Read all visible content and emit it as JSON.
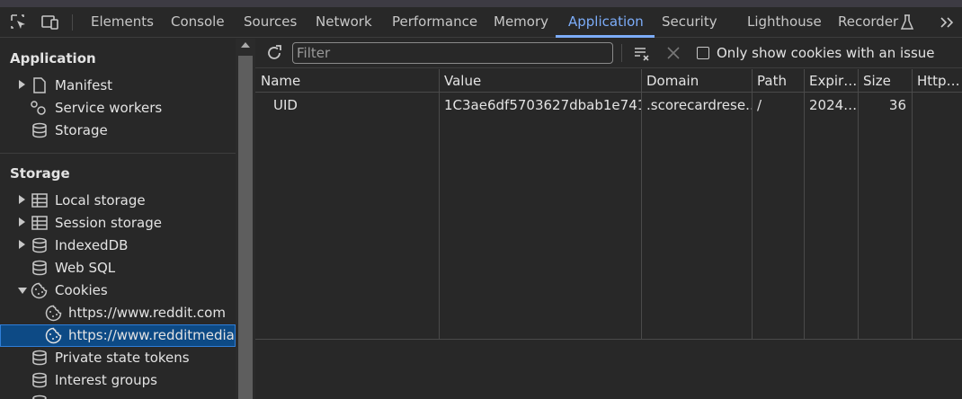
{
  "tabs": [
    {
      "label": "Elements"
    },
    {
      "label": "Console"
    },
    {
      "label": "Sources"
    },
    {
      "label": "Network"
    },
    {
      "label": "Performance"
    },
    {
      "label": "Memory"
    },
    {
      "label": "Application",
      "active": true
    },
    {
      "label": "Security"
    },
    {
      "label": "Lighthouse"
    },
    {
      "label": "Recorder"
    }
  ],
  "sidebar": {
    "application_heading": "Application",
    "application_items": [
      {
        "label": "Manifest",
        "icon": "document-icon"
      },
      {
        "label": "Service workers",
        "icon": "gears-icon"
      },
      {
        "label": "Storage",
        "icon": "database-icon"
      }
    ],
    "storage_heading": "Storage",
    "storage_items": [
      {
        "label": "Local storage",
        "icon": "table-icon"
      },
      {
        "label": "Session storage",
        "icon": "table-icon"
      },
      {
        "label": "IndexedDB",
        "icon": "database-icon"
      },
      {
        "label": "Web SQL",
        "icon": "database-icon"
      },
      {
        "label": "Cookies",
        "icon": "cookie-icon"
      },
      {
        "label": "https://www.reddit.com",
        "icon": "cookie-icon"
      },
      {
        "label": "https://www.redditmedia.com",
        "icon": "cookie-icon",
        "selected": true
      },
      {
        "label": "Private state tokens",
        "icon": "database-icon"
      },
      {
        "label": "Interest groups",
        "icon": "database-icon"
      }
    ]
  },
  "toolbar": {
    "filter_placeholder": "Filter",
    "only_issues_label": "Only show cookies with an issue"
  },
  "table": {
    "columns": [
      "Name",
      "Value",
      "Domain",
      "Path",
      "Expir…",
      "Size",
      "Http…"
    ],
    "rows": [
      [
        "UID",
        "1C3ae6df5703627dbab1e7416…",
        ".scorecardrese…",
        "/",
        "2024…",
        "36",
        ""
      ]
    ]
  },
  "colors": {
    "accent": "#7cacf8",
    "selected_bg": "#0d4a85"
  }
}
